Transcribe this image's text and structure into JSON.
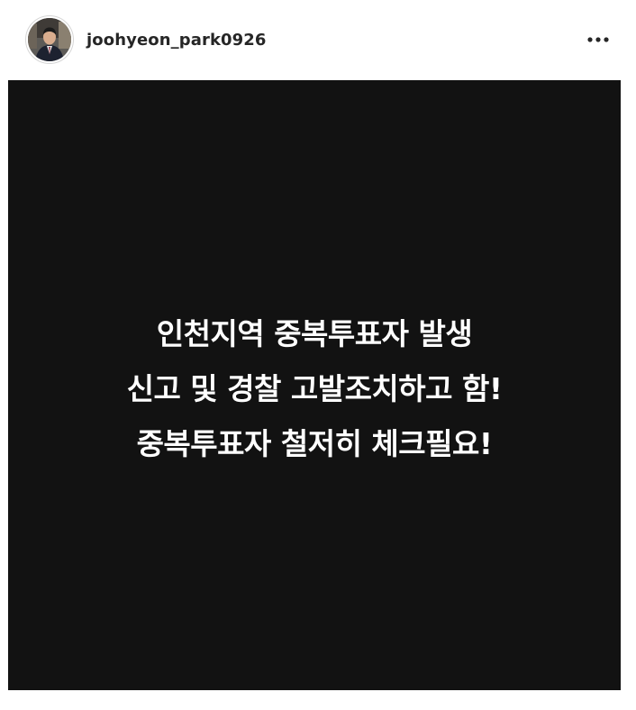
{
  "post": {
    "username": "joohyeon_park0926",
    "more_icon": "more-horizontal-icon",
    "image": {
      "background_color": "#121212",
      "text_color": "#ffffff",
      "lines": [
        "인천지역 중복투표자 발생",
        "신고 및 경찰 고발조치하고 함!",
        "중복투표자 철저히 체크필요!"
      ]
    }
  }
}
